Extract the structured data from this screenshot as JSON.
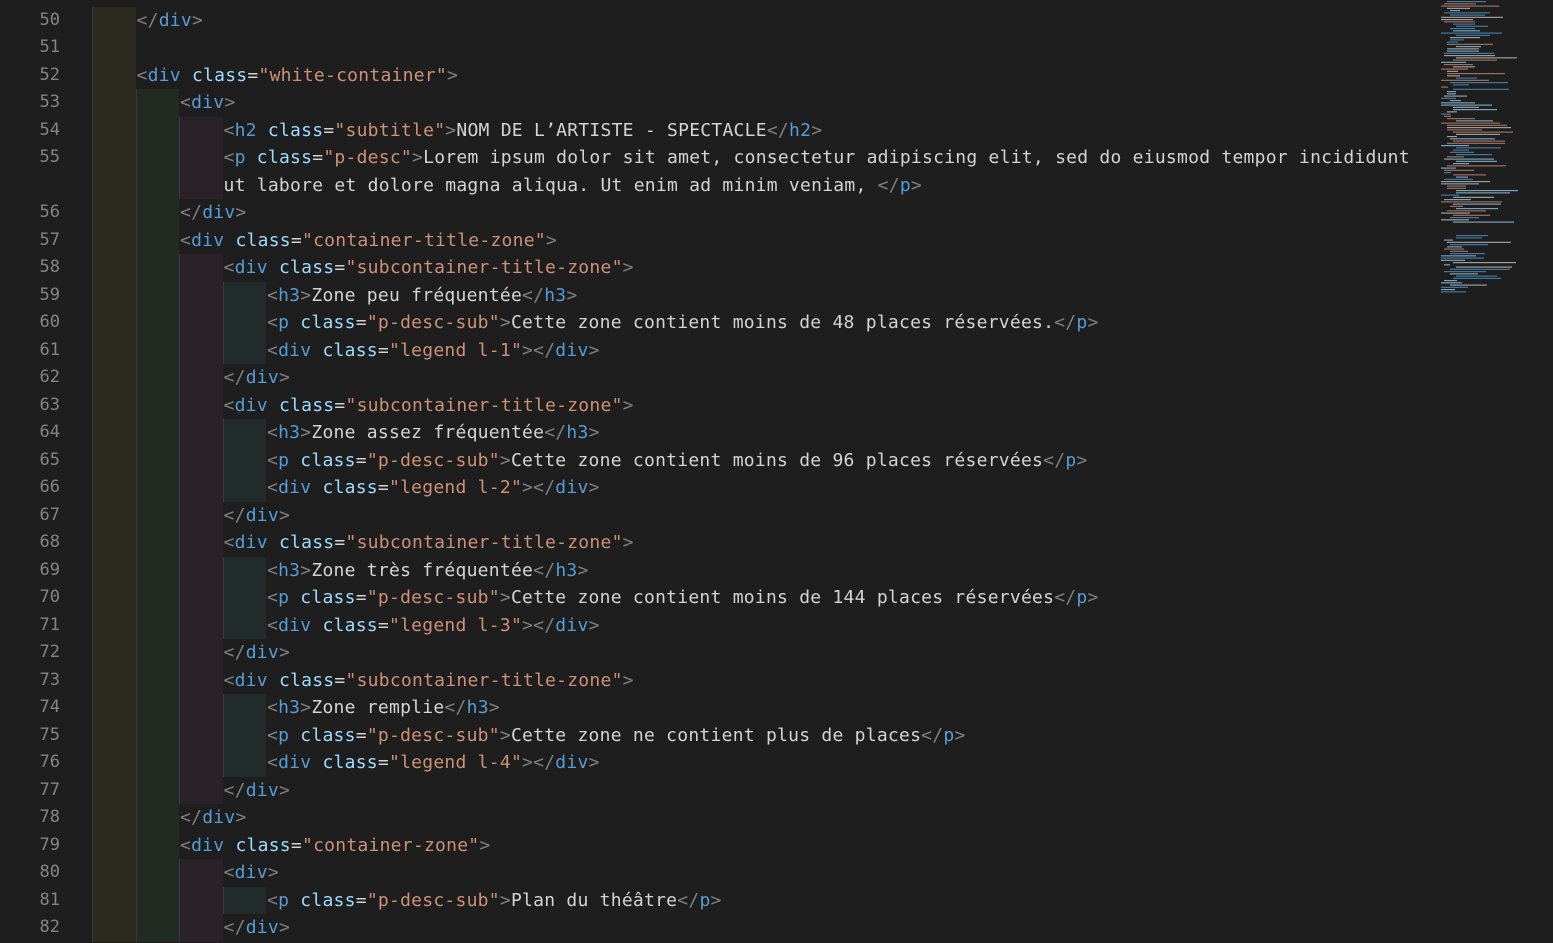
{
  "editor": {
    "lines": [
      {
        "n": "50",
        "indent": 1,
        "tokens": [
          [
            "br",
            "</"
          ],
          [
            "tg",
            "div"
          ],
          [
            "br",
            ">"
          ]
        ]
      },
      {
        "n": "51",
        "indent": 0,
        "tokens": []
      },
      {
        "n": "52",
        "indent": 1,
        "tokens": [
          [
            "br",
            "<"
          ],
          [
            "tg",
            "div"
          ],
          [
            "tx",
            " "
          ],
          [
            "at",
            "class"
          ],
          [
            "tx",
            "="
          ],
          [
            "st",
            "\"white-container\""
          ],
          [
            "br",
            ">"
          ]
        ]
      },
      {
        "n": "53",
        "indent": 2,
        "tokens": [
          [
            "br",
            "<"
          ],
          [
            "tg",
            "div"
          ],
          [
            "br",
            ">"
          ]
        ]
      },
      {
        "n": "54",
        "indent": 3,
        "tokens": [
          [
            "br",
            "<"
          ],
          [
            "tg",
            "h2"
          ],
          [
            "tx",
            " "
          ],
          [
            "at",
            "class"
          ],
          [
            "tx",
            "="
          ],
          [
            "st",
            "\"subtitle\""
          ],
          [
            "br",
            ">"
          ],
          [
            "tx",
            "NOM DE L’ARTISTE - SPECTACLE"
          ],
          [
            "br",
            "</"
          ],
          [
            "tg",
            "h2"
          ],
          [
            "br",
            ">"
          ]
        ]
      },
      {
        "n": "55",
        "indent": 3,
        "tokens": [
          [
            "br",
            "<"
          ],
          [
            "tg",
            "p"
          ],
          [
            "tx",
            " "
          ],
          [
            "at",
            "class"
          ],
          [
            "tx",
            "="
          ],
          [
            "st",
            "\"p-desc\""
          ],
          [
            "br",
            ">"
          ],
          [
            "tx",
            "Lorem ipsum dolor sit amet, consectetur adipiscing elit, sed do eiusmod tempor incididunt"
          ]
        ]
      },
      {
        "n": "",
        "indent": 3,
        "wrap": true,
        "tokens": [
          [
            "tx",
            "ut labore et dolore magna aliqua. Ut enim ad minim veniam, "
          ],
          [
            "br",
            "</"
          ],
          [
            "tg",
            "p"
          ],
          [
            "br",
            ">"
          ]
        ]
      },
      {
        "n": "56",
        "indent": 2,
        "tokens": [
          [
            "br",
            "</"
          ],
          [
            "tg",
            "div"
          ],
          [
            "br",
            ">"
          ]
        ]
      },
      {
        "n": "57",
        "indent": 2,
        "tokens": [
          [
            "br",
            "<"
          ],
          [
            "tg",
            "div"
          ],
          [
            "tx",
            " "
          ],
          [
            "at",
            "class"
          ],
          [
            "tx",
            "="
          ],
          [
            "st",
            "\"container-title-zone\""
          ],
          [
            "br",
            ">"
          ]
        ]
      },
      {
        "n": "58",
        "indent": 3,
        "tokens": [
          [
            "br",
            "<"
          ],
          [
            "tg",
            "div"
          ],
          [
            "tx",
            " "
          ],
          [
            "at",
            "class"
          ],
          [
            "tx",
            "="
          ],
          [
            "st",
            "\"subcontainer-title-zone\""
          ],
          [
            "br",
            ">"
          ]
        ]
      },
      {
        "n": "59",
        "indent": 4,
        "tokens": [
          [
            "br",
            "<"
          ],
          [
            "tg",
            "h3"
          ],
          [
            "br",
            ">"
          ],
          [
            "tx",
            "Zone peu fréquentée"
          ],
          [
            "br",
            "</"
          ],
          [
            "tg",
            "h3"
          ],
          [
            "br",
            ">"
          ]
        ]
      },
      {
        "n": "60",
        "indent": 4,
        "tokens": [
          [
            "br",
            "<"
          ],
          [
            "tg",
            "p"
          ],
          [
            "tx",
            " "
          ],
          [
            "at",
            "class"
          ],
          [
            "tx",
            "="
          ],
          [
            "st",
            "\"p-desc-sub\""
          ],
          [
            "br",
            ">"
          ],
          [
            "tx",
            "Cette zone contient moins de 48 places réservées."
          ],
          [
            "br",
            "</"
          ],
          [
            "tg",
            "p"
          ],
          [
            "br",
            ">"
          ]
        ]
      },
      {
        "n": "61",
        "indent": 4,
        "tokens": [
          [
            "br",
            "<"
          ],
          [
            "tg",
            "div"
          ],
          [
            "tx",
            " "
          ],
          [
            "at",
            "class"
          ],
          [
            "tx",
            "="
          ],
          [
            "st",
            "\"legend l-1\""
          ],
          [
            "br",
            "></"
          ],
          [
            "tg",
            "div"
          ],
          [
            "br",
            ">"
          ]
        ]
      },
      {
        "n": "62",
        "indent": 3,
        "tokens": [
          [
            "br",
            "</"
          ],
          [
            "tg",
            "div"
          ],
          [
            "br",
            ">"
          ]
        ]
      },
      {
        "n": "63",
        "indent": 3,
        "tokens": [
          [
            "br",
            "<"
          ],
          [
            "tg",
            "div"
          ],
          [
            "tx",
            " "
          ],
          [
            "at",
            "class"
          ],
          [
            "tx",
            "="
          ],
          [
            "st",
            "\"subcontainer-title-zone\""
          ],
          [
            "br",
            ">"
          ]
        ]
      },
      {
        "n": "64",
        "indent": 4,
        "tokens": [
          [
            "br",
            "<"
          ],
          [
            "tg",
            "h3"
          ],
          [
            "br",
            ">"
          ],
          [
            "tx",
            "Zone assez fréquentée"
          ],
          [
            "br",
            "</"
          ],
          [
            "tg",
            "h3"
          ],
          [
            "br",
            ">"
          ]
        ]
      },
      {
        "n": "65",
        "indent": 4,
        "tokens": [
          [
            "br",
            "<"
          ],
          [
            "tg",
            "p"
          ],
          [
            "tx",
            " "
          ],
          [
            "at",
            "class"
          ],
          [
            "tx",
            "="
          ],
          [
            "st",
            "\"p-desc-sub\""
          ],
          [
            "br",
            ">"
          ],
          [
            "tx",
            "Cette zone contient moins de 96 places réservées"
          ],
          [
            "br",
            "</"
          ],
          [
            "tg",
            "p"
          ],
          [
            "br",
            ">"
          ]
        ]
      },
      {
        "n": "66",
        "indent": 4,
        "tokens": [
          [
            "br",
            "<"
          ],
          [
            "tg",
            "div"
          ],
          [
            "tx",
            " "
          ],
          [
            "at",
            "class"
          ],
          [
            "tx",
            "="
          ],
          [
            "st",
            "\"legend l-2\""
          ],
          [
            "br",
            "></"
          ],
          [
            "tg",
            "div"
          ],
          [
            "br",
            ">"
          ]
        ]
      },
      {
        "n": "67",
        "indent": 3,
        "tokens": [
          [
            "br",
            "</"
          ],
          [
            "tg",
            "div"
          ],
          [
            "br",
            ">"
          ]
        ]
      },
      {
        "n": "68",
        "indent": 3,
        "tokens": [
          [
            "br",
            "<"
          ],
          [
            "tg",
            "div"
          ],
          [
            "tx",
            " "
          ],
          [
            "at",
            "class"
          ],
          [
            "tx",
            "="
          ],
          [
            "st",
            "\"subcontainer-title-zone\""
          ],
          [
            "br",
            ">"
          ]
        ]
      },
      {
        "n": "69",
        "indent": 4,
        "tokens": [
          [
            "br",
            "<"
          ],
          [
            "tg",
            "h3"
          ],
          [
            "br",
            ">"
          ],
          [
            "tx",
            "Zone très fréquentée"
          ],
          [
            "br",
            "</"
          ],
          [
            "tg",
            "h3"
          ],
          [
            "br",
            ">"
          ]
        ]
      },
      {
        "n": "70",
        "indent": 4,
        "tokens": [
          [
            "br",
            "<"
          ],
          [
            "tg",
            "p"
          ],
          [
            "tx",
            " "
          ],
          [
            "at",
            "class"
          ],
          [
            "tx",
            "="
          ],
          [
            "st",
            "\"p-desc-sub\""
          ],
          [
            "br",
            ">"
          ],
          [
            "tx",
            "Cette zone contient moins de 144 places réservées"
          ],
          [
            "br",
            "</"
          ],
          [
            "tg",
            "p"
          ],
          [
            "br",
            ">"
          ]
        ]
      },
      {
        "n": "71",
        "indent": 4,
        "tokens": [
          [
            "br",
            "<"
          ],
          [
            "tg",
            "div"
          ],
          [
            "tx",
            " "
          ],
          [
            "at",
            "class"
          ],
          [
            "tx",
            "="
          ],
          [
            "st",
            "\"legend l-3\""
          ],
          [
            "br",
            "></"
          ],
          [
            "tg",
            "div"
          ],
          [
            "br",
            ">"
          ]
        ]
      },
      {
        "n": "72",
        "indent": 3,
        "tokens": [
          [
            "br",
            "</"
          ],
          [
            "tg",
            "div"
          ],
          [
            "br",
            ">"
          ]
        ]
      },
      {
        "n": "73",
        "indent": 3,
        "tokens": [
          [
            "br",
            "<"
          ],
          [
            "tg",
            "div"
          ],
          [
            "tx",
            " "
          ],
          [
            "at",
            "class"
          ],
          [
            "tx",
            "="
          ],
          [
            "st",
            "\"subcontainer-title-zone\""
          ],
          [
            "br",
            ">"
          ]
        ]
      },
      {
        "n": "74",
        "indent": 4,
        "tokens": [
          [
            "br",
            "<"
          ],
          [
            "tg",
            "h3"
          ],
          [
            "br",
            ">"
          ],
          [
            "tx",
            "Zone remplie"
          ],
          [
            "br",
            "</"
          ],
          [
            "tg",
            "h3"
          ],
          [
            "br",
            ">"
          ]
        ]
      },
      {
        "n": "75",
        "indent": 4,
        "tokens": [
          [
            "br",
            "<"
          ],
          [
            "tg",
            "p"
          ],
          [
            "tx",
            " "
          ],
          [
            "at",
            "class"
          ],
          [
            "tx",
            "="
          ],
          [
            "st",
            "\"p-desc-sub\""
          ],
          [
            "br",
            ">"
          ],
          [
            "tx",
            "Cette zone ne contient plus de places"
          ],
          [
            "br",
            "</"
          ],
          [
            "tg",
            "p"
          ],
          [
            "br",
            ">"
          ]
        ]
      },
      {
        "n": "76",
        "indent": 4,
        "tokens": [
          [
            "br",
            "<"
          ],
          [
            "tg",
            "div"
          ],
          [
            "tx",
            " "
          ],
          [
            "at",
            "class"
          ],
          [
            "tx",
            "="
          ],
          [
            "st",
            "\"legend l-4\""
          ],
          [
            "br",
            "></"
          ],
          [
            "tg",
            "div"
          ],
          [
            "br",
            ">"
          ]
        ]
      },
      {
        "n": "77",
        "indent": 3,
        "tokens": [
          [
            "br",
            "</"
          ],
          [
            "tg",
            "div"
          ],
          [
            "br",
            ">"
          ]
        ]
      },
      {
        "n": "78",
        "indent": 2,
        "tokens": [
          [
            "br",
            "</"
          ],
          [
            "tg",
            "div"
          ],
          [
            "br",
            ">"
          ]
        ]
      },
      {
        "n": "79",
        "indent": 2,
        "tokens": [
          [
            "br",
            "<"
          ],
          [
            "tg",
            "div"
          ],
          [
            "tx",
            " "
          ],
          [
            "at",
            "class"
          ],
          [
            "tx",
            "="
          ],
          [
            "st",
            "\"container-zone\""
          ],
          [
            "br",
            ">"
          ]
        ]
      },
      {
        "n": "80",
        "indent": 3,
        "tokens": [
          [
            "br",
            "<"
          ],
          [
            "tg",
            "div"
          ],
          [
            "br",
            ">"
          ]
        ]
      },
      {
        "n": "81",
        "indent": 4,
        "tokens": [
          [
            "br",
            "<"
          ],
          [
            "tg",
            "p"
          ],
          [
            "tx",
            " "
          ],
          [
            "at",
            "class"
          ],
          [
            "tx",
            "="
          ],
          [
            "st",
            "\"p-desc-sub\""
          ],
          [
            "br",
            ">"
          ],
          [
            "tx",
            "Plan du théâtre"
          ],
          [
            "br",
            "</"
          ],
          [
            "tg",
            "p"
          ],
          [
            "br",
            ">"
          ]
        ]
      },
      {
        "n": "82",
        "indent": 3,
        "tokens": [
          [
            "br",
            "</"
          ],
          [
            "tg",
            "div"
          ],
          [
            "br",
            ">"
          ]
        ]
      }
    ]
  }
}
